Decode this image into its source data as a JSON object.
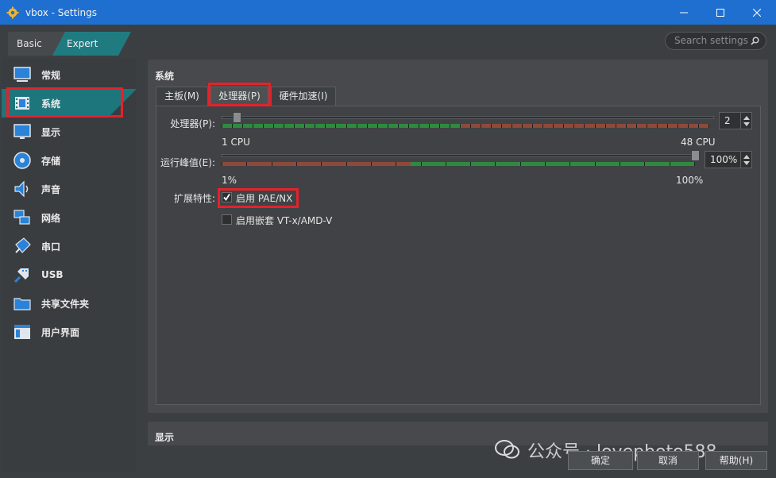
{
  "window": {
    "title": "vbox - Settings"
  },
  "mode": {
    "basic": "Basic",
    "expert": "Expert"
  },
  "search": {
    "placeholder": "Search settings"
  },
  "sidebar": {
    "items": [
      {
        "label": "常规",
        "icon": "monitor-icon"
      },
      {
        "label": "系统",
        "icon": "chip-icon",
        "active": true
      },
      {
        "label": "显示",
        "icon": "display-icon"
      },
      {
        "label": "存储",
        "icon": "disk-icon"
      },
      {
        "label": "声音",
        "icon": "speaker-icon"
      },
      {
        "label": "网络",
        "icon": "network-icon"
      },
      {
        "label": "串口",
        "icon": "serial-port-icon"
      },
      {
        "label": "USB",
        "icon": "usb-icon"
      },
      {
        "label": "共享文件夹",
        "icon": "folder-icon"
      },
      {
        "label": "用户界面",
        "icon": "ui-window-icon"
      }
    ]
  },
  "section": {
    "title": "系统"
  },
  "tabs": [
    {
      "label": "主板(M)"
    },
    {
      "label": "处理器(P)",
      "active": true
    },
    {
      "label": "硬件加速(I)"
    }
  ],
  "processor": {
    "label": "处理器(P):",
    "value": "2",
    "min_label": "1 CPU",
    "max_label": "48 CPU",
    "min": 1,
    "max": 48
  },
  "execution_cap": {
    "label": "运行峰值(E):",
    "value": "100%",
    "min_label": "1%",
    "max_label": "100%",
    "level_percent": 100
  },
  "extended": {
    "label": "扩展特性:",
    "pae_label": "启用 PAE/NX",
    "pae_checked": true,
    "nested_label": "启用嵌套 VT-x/AMD-V",
    "nested_checked": false
  },
  "display_section": {
    "title": "显示"
  },
  "buttons": {
    "ok": "确定",
    "cancel": "取消",
    "help": "帮助(H)"
  },
  "watermark": {
    "text": "公众号 · lovephoto588"
  },
  "colors": {
    "titlebar": "#1f6fd0",
    "accent": "#1d767c",
    "highlight": "#e4222a"
  }
}
